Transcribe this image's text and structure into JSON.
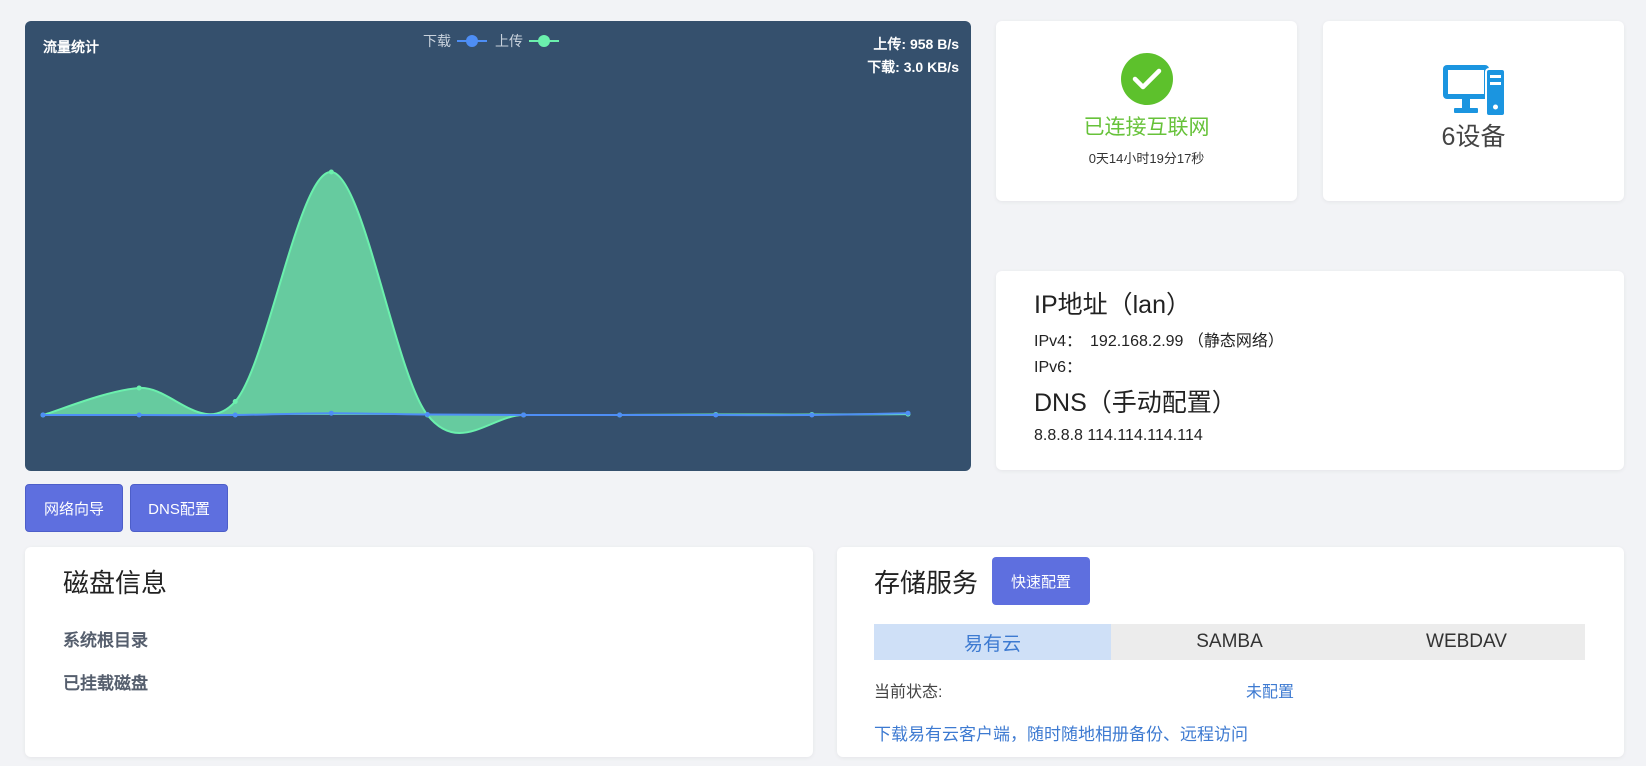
{
  "traffic": {
    "title": "流量统计",
    "legend": {
      "download": {
        "label": "下载",
        "color": "#4e8ef5"
      },
      "upload": {
        "label": "上传",
        "color": "#6bf0ad"
      }
    },
    "rates": {
      "upload": "上传: 958 B/s",
      "download": "下载: 3.0 KB/s"
    }
  },
  "chart_data": {
    "type": "area",
    "series": [
      {
        "name": "上传",
        "color": "#6bf0ad",
        "values": [
          0,
          30,
          15,
          270,
          0,
          0,
          0,
          0.5,
          0.5,
          1
        ]
      },
      {
        "name": "下载",
        "color": "#4e8ef5",
        "values": [
          0,
          0,
          0,
          2,
          0.5,
          0,
          0,
          0,
          0,
          2
        ]
      }
    ],
    "ylim": [
      0,
      300
    ],
    "grid": false,
    "legend_position": "top-center"
  },
  "buttons": {
    "network_wizard": "网络向导",
    "dns_config": "DNS配置"
  },
  "internet": {
    "status": "已连接互联网",
    "uptime": "0天14小时19分17秒",
    "icon": "check-circle-icon"
  },
  "devices": {
    "count_label": "6设备",
    "icon": "monitor-icon"
  },
  "ip": {
    "title": "IP地址（lan）",
    "ipv4_label": "IPv4：",
    "ipv4_value": "192.168.2.99 （静态网络）",
    "ipv6_label": "IPv6：",
    "dns_title": "DNS（手动配置）",
    "dns_value": "8.8.8.8 114.114.114.114"
  },
  "disk": {
    "title": "磁盘信息",
    "items": [
      "系统根目录",
      "已挂载磁盘"
    ]
  },
  "storage": {
    "title": "存储服务",
    "quick_config": "快速配置",
    "tabs": [
      "易有云",
      "SAMBA",
      "WEBDAV"
    ],
    "status_label": "当前状态:",
    "status_value": "未配置",
    "link": "下载易有云客户端，随时随地相册备份、远程访问"
  }
}
